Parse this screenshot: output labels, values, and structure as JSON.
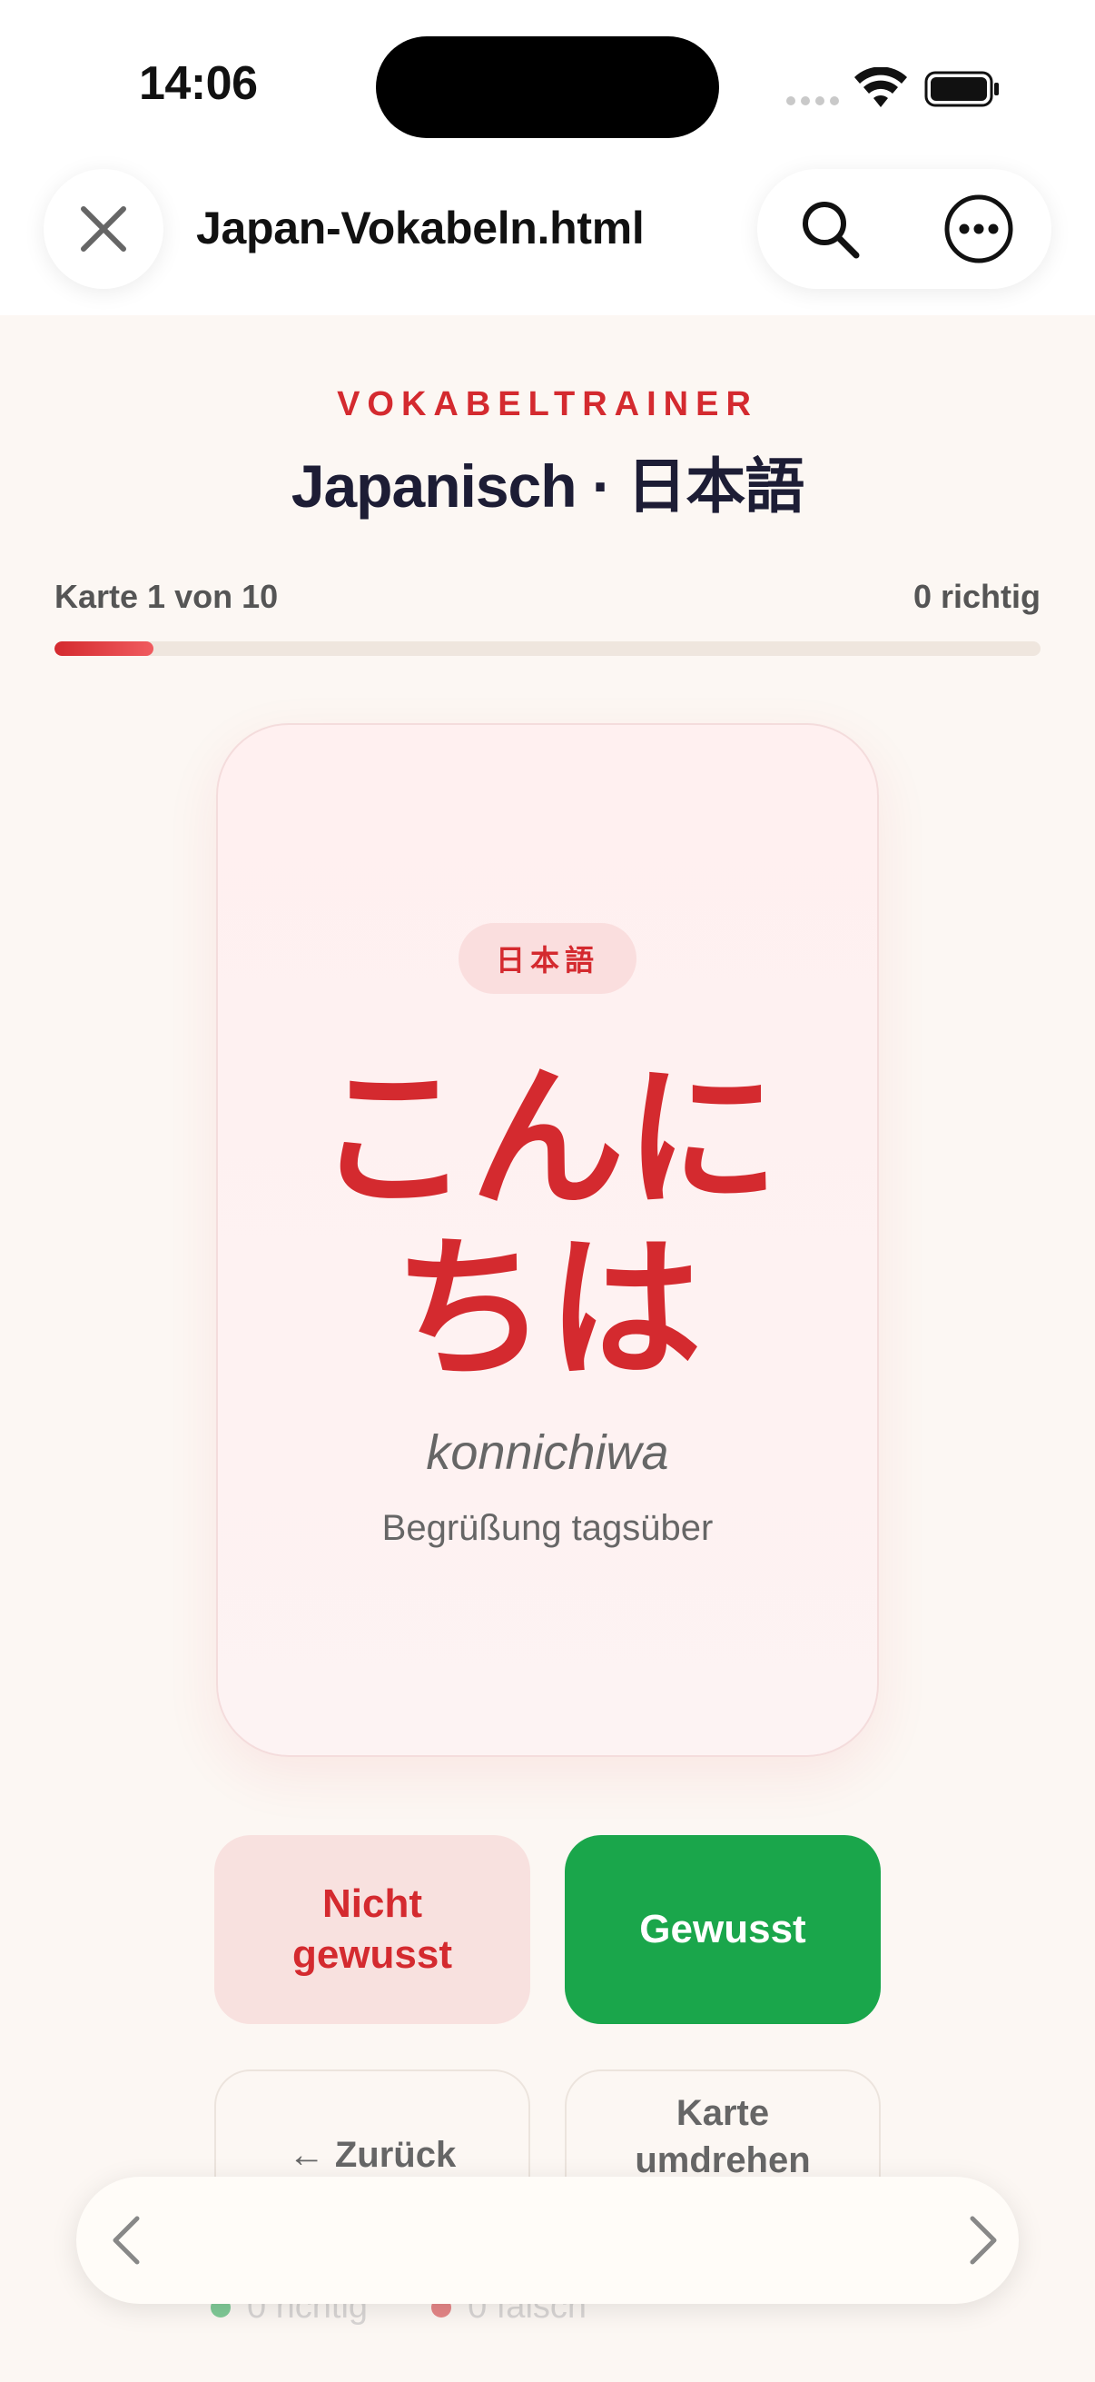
{
  "status_bar": {
    "time": "14:06"
  },
  "browser": {
    "filename": "Japan-Vokabeln.html",
    "icons": {
      "close": "close-icon",
      "search": "search-icon",
      "more": "more-icon",
      "back": "chevron-left-icon",
      "forward": "chevron-right-icon"
    }
  },
  "header": {
    "eyebrow": "VOKABELTRAINER",
    "title": "Japanisch · 日本語"
  },
  "progress": {
    "label": "Karte 1 von 10",
    "score": "0 richtig",
    "fraction": 0.1
  },
  "card": {
    "badge": "日本語",
    "word_line1": "こんに",
    "word_line2": "ちは",
    "romaji": "konnichiwa",
    "meaning": "Begrüßung tagsüber"
  },
  "actions": {
    "wrong": "Nicht gewusst",
    "right": "Gewusst",
    "back": "← Zurück",
    "flip": "Karte umdrehen"
  },
  "stats": {
    "correct": "0 richtig",
    "wrong": "0 falsch"
  },
  "colors": {
    "accent": "#d42a2f",
    "success": "#1aa64b",
    "background": "#fcf7f3"
  }
}
